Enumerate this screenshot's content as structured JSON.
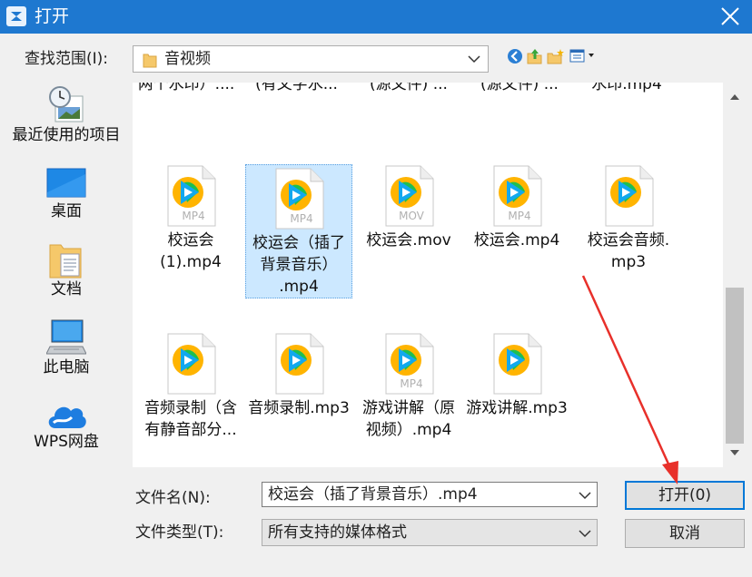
{
  "window": {
    "title": "打开",
    "title_icon": "app-logo-icon",
    "close_icon": "close-icon"
  },
  "lookin": {
    "label": "查找范围(I):",
    "value": "音视频"
  },
  "toolbar": [
    "back-icon",
    "up-folder-icon",
    "new-folder-icon",
    "view-menu-icon"
  ],
  "places": [
    {
      "label": "最近使用的项目",
      "icon": "recent-items-icon"
    },
    {
      "label": "桌面",
      "icon": "desktop-icon"
    },
    {
      "label": "文档",
      "icon": "documents-icon"
    },
    {
      "label": "此电脑",
      "icon": "this-pc-icon"
    },
    {
      "label": "WPS网盘",
      "icon": "wps-cloud-icon"
    }
  ],
  "files_partial": [
    "两个水印）....",
    "(有文字水...",
    "(源文件)  ...",
    "(源文件)  ...",
    "水印.mp4"
  ],
  "files": [
    {
      "name_lines": [
        "校运会",
        "(1).mp4"
      ],
      "badge": "MP4"
    },
    {
      "name_lines": [
        "校运会（插了",
        "背景音乐）",
        ".mp4"
      ],
      "badge": "MP4"
    },
    {
      "name_lines": [
        "校运会.mov"
      ],
      "badge": "MOV"
    },
    {
      "name_lines": [
        "校运会.mp4"
      ],
      "badge": "MP4"
    },
    {
      "name_lines": [
        "校运会音频.",
        "mp3"
      ],
      "badge": ""
    },
    {
      "name_lines": [
        "音频录制（含",
        "有静音部分..."
      ],
      "badge": ""
    },
    {
      "name_lines": [
        "音频录制.mp3"
      ],
      "badge": ""
    },
    {
      "name_lines": [
        "游戏讲解（原",
        "视频）.mp4"
      ],
      "badge": "MP4"
    },
    {
      "name_lines": [
        "游戏讲解.mp3"
      ],
      "badge": ""
    }
  ],
  "selected_file": "校运会（插了背景音乐）.mp4",
  "filename": {
    "label": "文件名(N):",
    "value": "校运会（插了背景音乐）.mp4"
  },
  "filetype": {
    "label": "文件类型(T):",
    "value": "所有支持的媒体格式"
  },
  "buttons": {
    "open": "打开(0)",
    "cancel": "取消"
  },
  "colors": {
    "titlebar": "#1e78d0",
    "selection": "#cce8ff",
    "annotation_arrow": "#e8302a"
  }
}
